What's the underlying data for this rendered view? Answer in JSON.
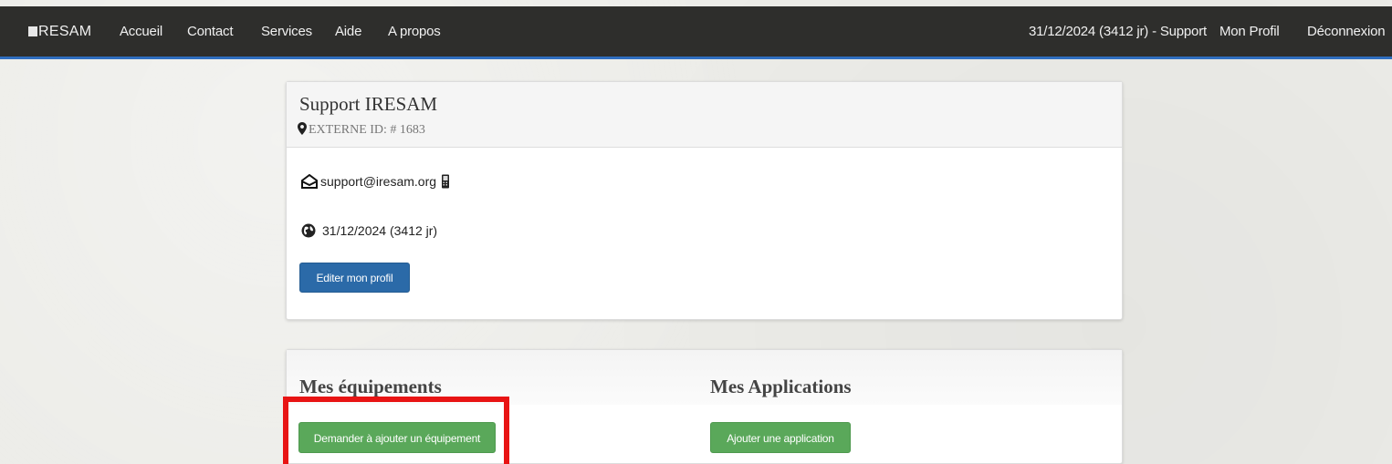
{
  "navbar": {
    "brand": "RESAM",
    "links": [
      "Accueil",
      "Contact",
      "Services",
      "Aide",
      "A propos"
    ],
    "status": "31/12/2024 (3412 jr) - Support",
    "profile": "Mon Profil",
    "logout": "Déconnexion"
  },
  "profile": {
    "name": "Support IRESAM",
    "id_label": "EXTERNE ID: # 1683",
    "email": "support@iresam.org",
    "date": "31/12/2024 (3412 jr)",
    "edit_button": "Editer mon profil"
  },
  "equipment": {
    "title": "Mes équipements",
    "button": "Demander à ajouter un équipement"
  },
  "applications": {
    "title": "Mes Applications",
    "button": "Ajouter une application"
  },
  "colors": {
    "navbar": "#2e2e2c",
    "navbar_accent": "#2f6ec0",
    "primary_button": "#2b6aa8",
    "success_button": "#5aa85a",
    "highlight": "#e81414"
  },
  "icons": [
    "map-marker-icon",
    "envelope-open-icon",
    "mobile-phone-icon",
    "globe-icon"
  ]
}
